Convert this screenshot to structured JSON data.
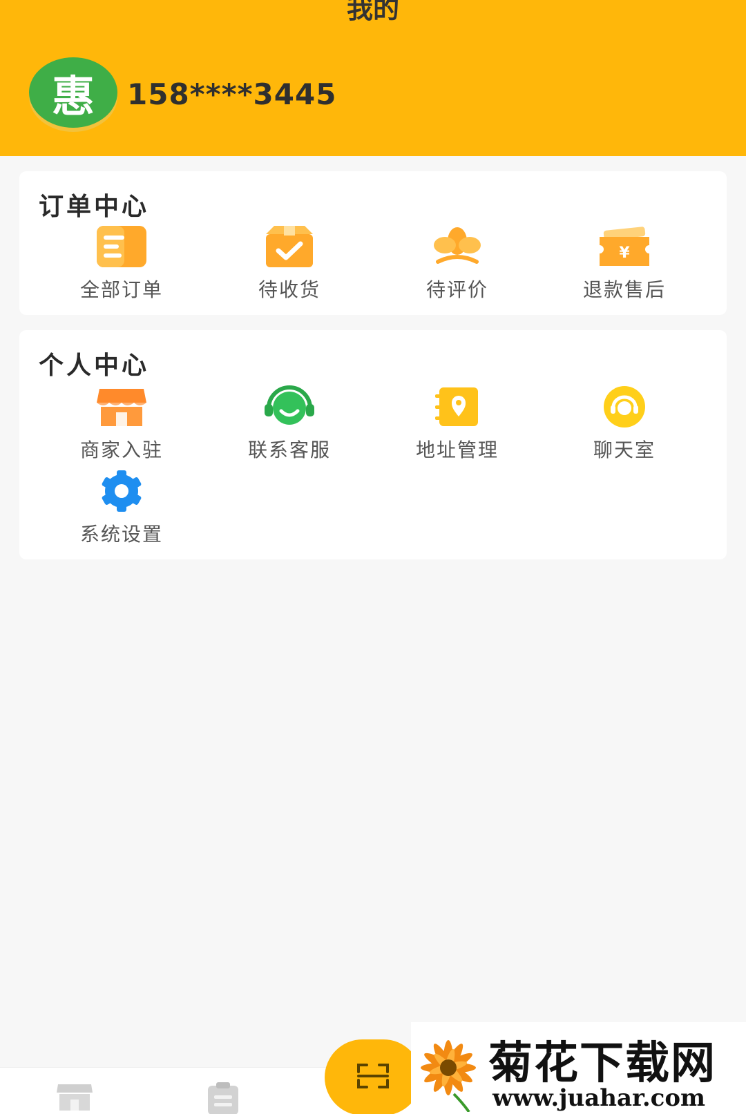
{
  "header": {
    "title": "我的",
    "avatar_char": "惠",
    "phone": "158****3445",
    "color": "#ffb70a"
  },
  "order_center": {
    "title": "订单中心",
    "items": [
      {
        "label": "全部订单",
        "icon": "order-list-icon"
      },
      {
        "label": "待收货",
        "icon": "package-check-icon"
      },
      {
        "label": "待评价",
        "icon": "flower-rate-icon"
      },
      {
        "label": "退款售后",
        "icon": "refund-ticket-icon"
      }
    ]
  },
  "personal_center": {
    "title": "个人中心",
    "items": [
      {
        "label": "商家入驻",
        "icon": "storefront-icon"
      },
      {
        "label": "联系客服",
        "icon": "headset-service-icon"
      },
      {
        "label": "地址管理",
        "icon": "address-book-icon"
      },
      {
        "label": "聊天室",
        "icon": "chat-room-icon"
      },
      {
        "label": "系统设置",
        "icon": "gear-icon"
      }
    ]
  },
  "bottom_nav": {
    "items": [
      {
        "icon": "shop-tab-icon"
      },
      {
        "icon": "orders-tab-icon"
      },
      {
        "icon": "scan-icon"
      }
    ]
  },
  "watermark": {
    "title": "菊花下载网",
    "url": "www.juahar.com"
  }
}
